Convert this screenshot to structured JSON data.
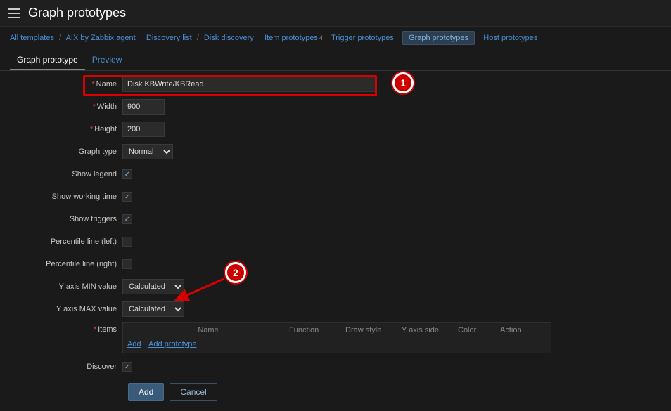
{
  "header": {
    "title": "Graph prototypes"
  },
  "breadcrumbs": {
    "all_templates": "All templates",
    "template": "AIX by Zabbix agent",
    "discovery_list": "Discovery list",
    "discovery_rule": "Disk discovery",
    "item_proto": "Item prototypes",
    "item_proto_count": "4",
    "trigger_proto": "Trigger prototypes",
    "graph_proto": "Graph prototypes",
    "host_proto": "Host prototypes"
  },
  "tabs": {
    "graph_prototype": "Graph prototype",
    "preview": "Preview"
  },
  "form": {
    "labels": {
      "name": "Name",
      "width": "Width",
      "height": "Height",
      "graph_type": "Graph type",
      "show_legend": "Show legend",
      "show_working_time": "Show working time",
      "show_triggers": "Show triggers",
      "percentile_left": "Percentile line (left)",
      "percentile_right": "Percentile line (right)",
      "y_min": "Y axis MIN value",
      "y_max": "Y axis MAX value",
      "items": "Items",
      "discover": "Discover"
    },
    "values": {
      "name": "Disk KBWrite/KBRead",
      "width": "900",
      "height": "200",
      "graph_type": "Normal",
      "y_min": "Calculated",
      "y_max": "Calculated"
    },
    "checks": {
      "show_legend": "✓",
      "show_working_time": "✓",
      "show_triggers": "✓",
      "percentile_left": "",
      "percentile_right": "",
      "discover": "✓"
    }
  },
  "items_table": {
    "headers": {
      "name": "Name",
      "function": "Function",
      "draw_style": "Draw style",
      "y_axis_side": "Y axis side",
      "color": "Color",
      "action": "Action"
    },
    "links": {
      "add": "Add",
      "add_prototype": "Add prototype"
    }
  },
  "buttons": {
    "add": "Add",
    "cancel": "Cancel"
  },
  "annotations": {
    "badge1": "1",
    "badge2": "2"
  }
}
